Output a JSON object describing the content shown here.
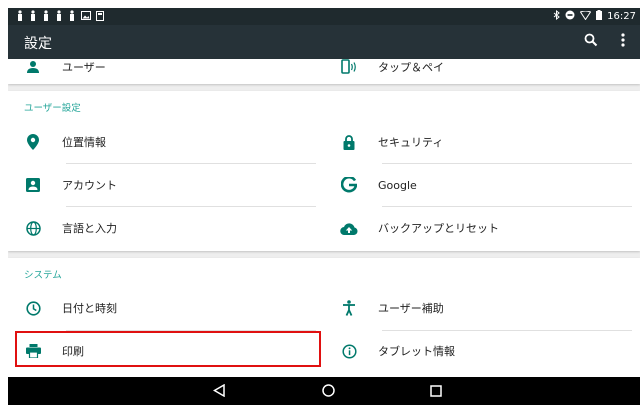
{
  "status_bar": {
    "time": "16:27"
  },
  "app_bar": {
    "title": "設定"
  },
  "colors": {
    "accent": "#26a69a",
    "icon": "#00796b",
    "appbar": "#263238",
    "highlight": "#e01010"
  },
  "top_items": [
    {
      "label": "ユーザー",
      "icon": "person-icon"
    },
    {
      "label": "タップ＆ペイ",
      "icon": "tap-pay-icon"
    }
  ],
  "sections": [
    {
      "title": "ユーザー設定",
      "items": [
        {
          "label": "位置情報",
          "icon": "location-icon"
        },
        {
          "label": "セキュリティ",
          "icon": "lock-icon"
        },
        {
          "label": "アカウント",
          "icon": "account-icon"
        },
        {
          "label": "Google",
          "icon": "google-icon"
        },
        {
          "label": "言語と入力",
          "icon": "globe-icon"
        },
        {
          "label": "バックアップとリセット",
          "icon": "cloud-upload-icon"
        }
      ]
    },
    {
      "title": "システム",
      "items": [
        {
          "label": "日付と時刻",
          "icon": "clock-icon"
        },
        {
          "label": "ユーザー補助",
          "icon": "accessibility-icon"
        },
        {
          "label": "印刷",
          "icon": "print-icon"
        },
        {
          "label": "タブレット情報",
          "icon": "info-icon"
        }
      ]
    }
  ]
}
